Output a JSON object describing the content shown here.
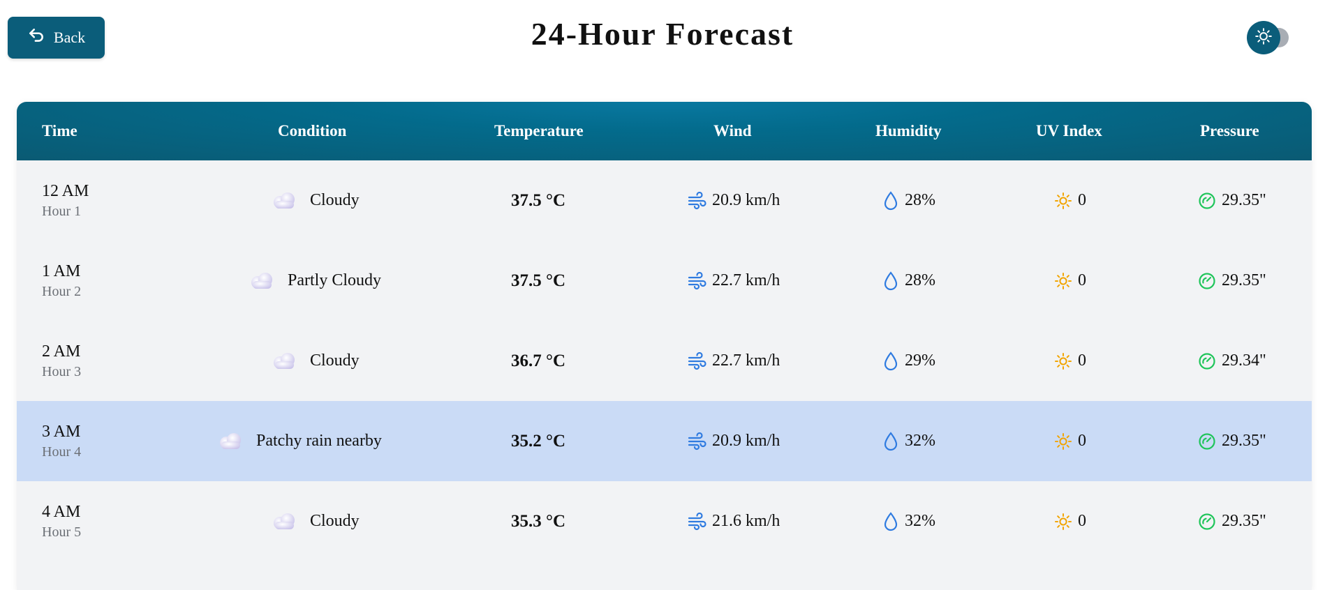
{
  "header": {
    "back_label": "Back",
    "title": "24-Hour Forecast",
    "theme_icon": "sun-icon"
  },
  "colors": {
    "primary": "#0b5d7a",
    "highlight_row": "#cadbf6",
    "wind": "#2f7be0",
    "humidity": "#2f7be0",
    "uv": "#f2a400",
    "pressure": "#1fc55a"
  },
  "table": {
    "columns": [
      "Time",
      "Condition",
      "Temperature",
      "Wind",
      "Humidity",
      "UV Index",
      "Pressure"
    ],
    "rows": [
      {
        "time": "12 AM",
        "hour": "Hour 1",
        "condition": "Cloudy",
        "temperature": "37.5 °C",
        "wind": "20.9 km/h",
        "humidity": "28%",
        "uv": "0",
        "pressure": "29.35\""
      },
      {
        "time": "1 AM",
        "hour": "Hour 2",
        "condition": "Partly Cloudy",
        "temperature": "37.5 °C",
        "wind": "22.7 km/h",
        "humidity": "28%",
        "uv": "0",
        "pressure": "29.35\""
      },
      {
        "time": "2 AM",
        "hour": "Hour 3",
        "condition": "Cloudy",
        "temperature": "36.7 °C",
        "wind": "22.7 km/h",
        "humidity": "29%",
        "uv": "0",
        "pressure": "29.34\""
      },
      {
        "time": "3 AM",
        "hour": "Hour 4",
        "condition": "Patchy rain nearby",
        "temperature": "35.2 °C",
        "wind": "20.9 km/h",
        "humidity": "32%",
        "uv": "0",
        "pressure": "29.35\"",
        "highlighted": true
      },
      {
        "time": "4 AM",
        "hour": "Hour 5",
        "condition": "Cloudy",
        "temperature": "35.3 °C",
        "wind": "21.6 km/h",
        "humidity": "32%",
        "uv": "0",
        "pressure": "29.35\""
      }
    ]
  }
}
